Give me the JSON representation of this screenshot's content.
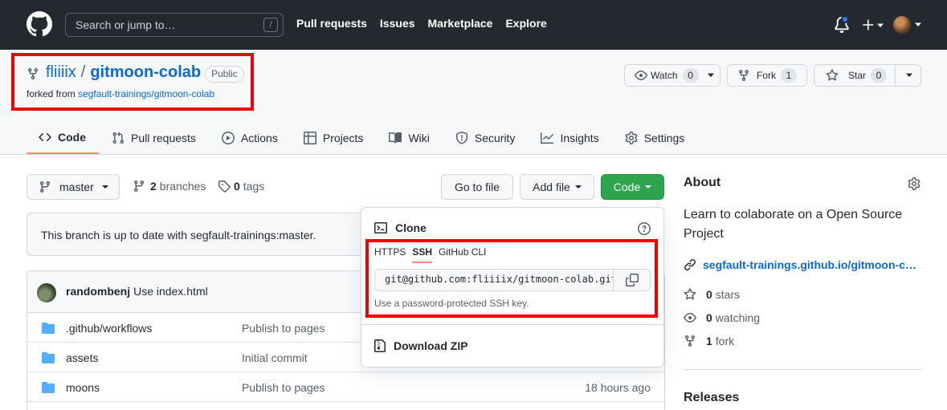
{
  "header": {
    "search_placeholder": "Search or jump to…",
    "search_shortcut": "/",
    "nav": [
      "Pull requests",
      "Issues",
      "Marketplace",
      "Explore"
    ]
  },
  "repo": {
    "owner": "fliiiix",
    "separator": "/",
    "name": "gitmoon-colab",
    "visibility": "Public",
    "forked_from_prefix": "forked from ",
    "forked_from": "segfault-trainings/gitmoon-colab",
    "watch_label": "Watch",
    "watch_count": "0",
    "fork_label": "Fork",
    "fork_count": "1",
    "star_label": "Star",
    "star_count": "0"
  },
  "tabs": [
    "Code",
    "Pull requests",
    "Actions",
    "Projects",
    "Wiki",
    "Security",
    "Insights",
    "Settings"
  ],
  "toolbar": {
    "branch": "master",
    "branches_count": "2",
    "branches_label": "branches",
    "tags_count": "0",
    "tags_label": "tags",
    "goto_file": "Go to file",
    "add_file": "Add file",
    "code": "Code"
  },
  "status": {
    "message": "This branch is up to date with segfault-trainings:master."
  },
  "latest_commit": {
    "author": "randombenj",
    "message": "Use index.html"
  },
  "files": [
    {
      "name_prefix": ".github/",
      "name": "workflows",
      "message": "Publish to pages",
      "time": ""
    },
    {
      "name_prefix": "",
      "name": "assets",
      "message": "Initial commit",
      "time": ""
    },
    {
      "name_prefix": "",
      "name": "moons",
      "message": "Publish to pages",
      "time": "18 hours ago"
    }
  ],
  "clone": {
    "title": "Clone",
    "tabs": [
      "HTTPS",
      "SSH",
      "GitHub CLI"
    ],
    "url": "git@github.com:fliiiix/gitmoon-colab.git",
    "hint": "Use a password-protected SSH key.",
    "download_zip": "Download ZIP"
  },
  "about": {
    "title": "About",
    "description": "Learn to colaborate on a Open Source Project",
    "link": "segfault-trainings.github.io/gitmoon-c…",
    "stars_count": "0",
    "stars_label": "stars",
    "watching_count": "0",
    "watching_label": "watching",
    "forks_count": "1",
    "forks_label": "fork",
    "releases_title": "Releases"
  },
  "colors": {
    "header_bg": "#24292f",
    "link": "#0969da",
    "primary_button": "#2da44e",
    "tab_underline": "#fd8c73",
    "highlight": "#f00000",
    "notification": "#2f81f7"
  }
}
